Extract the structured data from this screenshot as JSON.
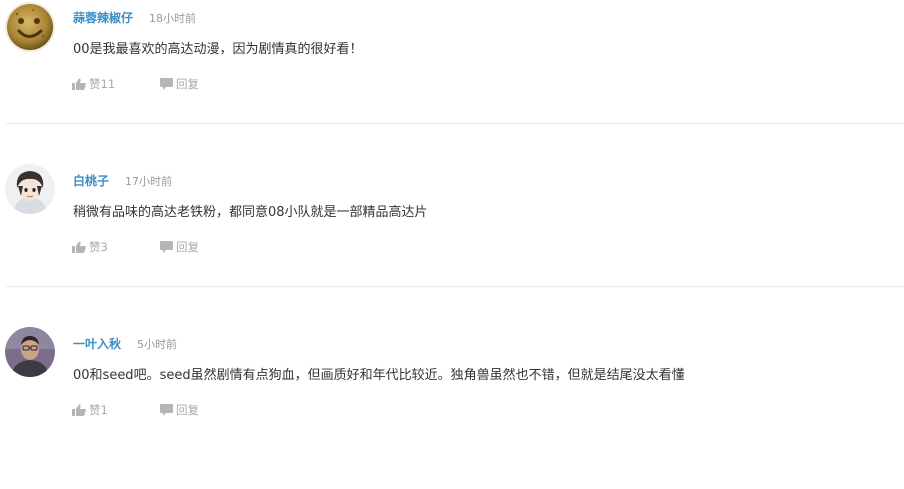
{
  "comments": [
    {
      "username": "蒜蓉辣椒仔",
      "time": "18小时前",
      "text": "00是我最喜欢的高达动漫，因为剧情真的很好看！",
      "like_label": "赞11",
      "reply_label": "回复",
      "avatar_icon": "smiley-cookie-avatar"
    },
    {
      "username": "白桃子",
      "time": "17小时前",
      "text": "稍微有品味的高达老铁粉，都同意08小队就是一部精品高达片",
      "like_label": "赞3",
      "reply_label": "回复",
      "avatar_icon": "anime-character-avatar"
    },
    {
      "username": "一叶入秋",
      "time": "5小时前",
      "text": "00和seed吧。seed虽然剧情有点狗血，但画质好和年代比较近。独角兽虽然也不错，但就是结尾没太看懂",
      "like_label": "赞1",
      "reply_label": "回复",
      "avatar_icon": "person-photo-avatar"
    }
  ],
  "icons": {
    "like": "thumbs-up-icon",
    "reply": "speech-bubble-icon"
  },
  "colors": {
    "username": "#3c8ec8",
    "meta": "#999999",
    "action": "#aaaaaa",
    "text": "#333333",
    "divider": "#ececec"
  }
}
